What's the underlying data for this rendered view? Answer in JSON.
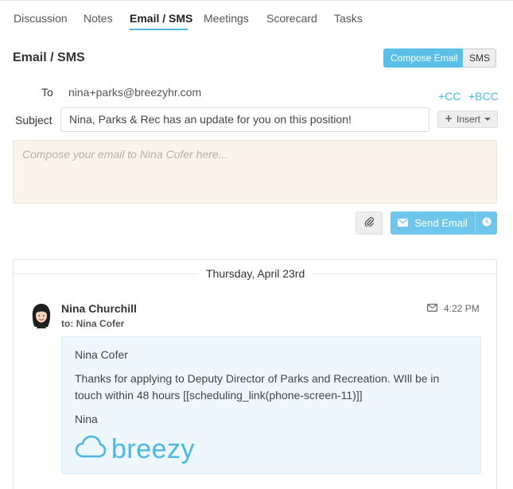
{
  "tabs": [
    {
      "label": "Discussion",
      "active": false
    },
    {
      "label": "Notes",
      "active": false
    },
    {
      "label": "Email / SMS",
      "active": true
    },
    {
      "label": "Meetings",
      "active": false
    },
    {
      "label": "Scorecard",
      "active": false
    },
    {
      "label": "Tasks",
      "active": false
    }
  ],
  "section_title": "Email / SMS",
  "mode_toggle": {
    "compose_label": "Compose Email",
    "sms_label": "SMS"
  },
  "form": {
    "to_label": "To",
    "to_value": "nina+parks@breezyhr.com",
    "cc_label": "+CC",
    "bcc_label": "+BCC",
    "subject_label": "Subject",
    "subject_value": "Nina, Parks & Rec has an update for you on this position!",
    "insert_label": "Insert",
    "compose_placeholder": "Compose your email to Nina Cofer here..."
  },
  "actions": {
    "send_label": "Send Email"
  },
  "thread": {
    "date": "Thursday, April 23rd",
    "message": {
      "sender": "Nina Churchill",
      "recipient": "to: Nina Cofer",
      "time": "4:22 PM",
      "greeting": "Nina Cofer",
      "body": "Thanks for applying to Deputy Director of Parks and Recreation. WIll be in touch within 48 hours [[scheduling_link(phone-screen-11)]]",
      "signoff": "Nina",
      "brand_name": "breezy"
    }
  },
  "colors": {
    "accent": "#4ab7e6",
    "button": "#6fc6ec",
    "compose_bg": "#fcf3ea",
    "message_bg": "#edf7fd"
  },
  "icons": [
    "plus-icon",
    "caret-down-icon",
    "paperclip-icon",
    "envelope-icon",
    "clock-icon",
    "cloud-logo-icon"
  ]
}
